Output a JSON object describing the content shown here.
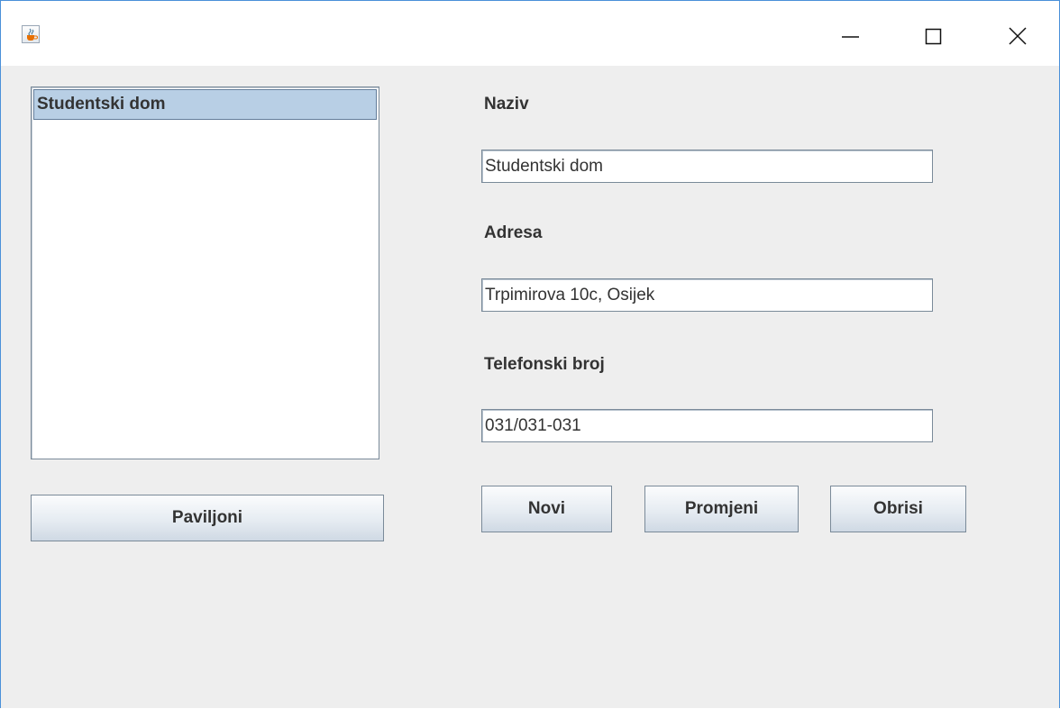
{
  "window": {
    "app_icon": "java-cup-icon",
    "controls": {
      "minimize_icon": "minimize-icon",
      "maximize_icon": "maximize-icon",
      "close_icon": "close-icon"
    }
  },
  "list": {
    "items": [
      {
        "label": "Studentski dom",
        "selected": true
      }
    ]
  },
  "buttons": {
    "paviljoni": "Paviljoni",
    "novi": "Novi",
    "promjeni": "Promjeni",
    "obrisi": "Obrisi"
  },
  "form": {
    "naziv": {
      "label": "Naziv",
      "value": "Studentski dom"
    },
    "adresa": {
      "label": "Adresa",
      "value": "Trpimirova 10c, Osijek"
    },
    "telefon": {
      "label": "Telefonski broj",
      "value": "031/031-031"
    }
  },
  "colors": {
    "window_border": "#4a90d9",
    "content_background": "#eeeeee",
    "selection_background": "#b8cfe5",
    "selection_border": "#637d9a"
  }
}
